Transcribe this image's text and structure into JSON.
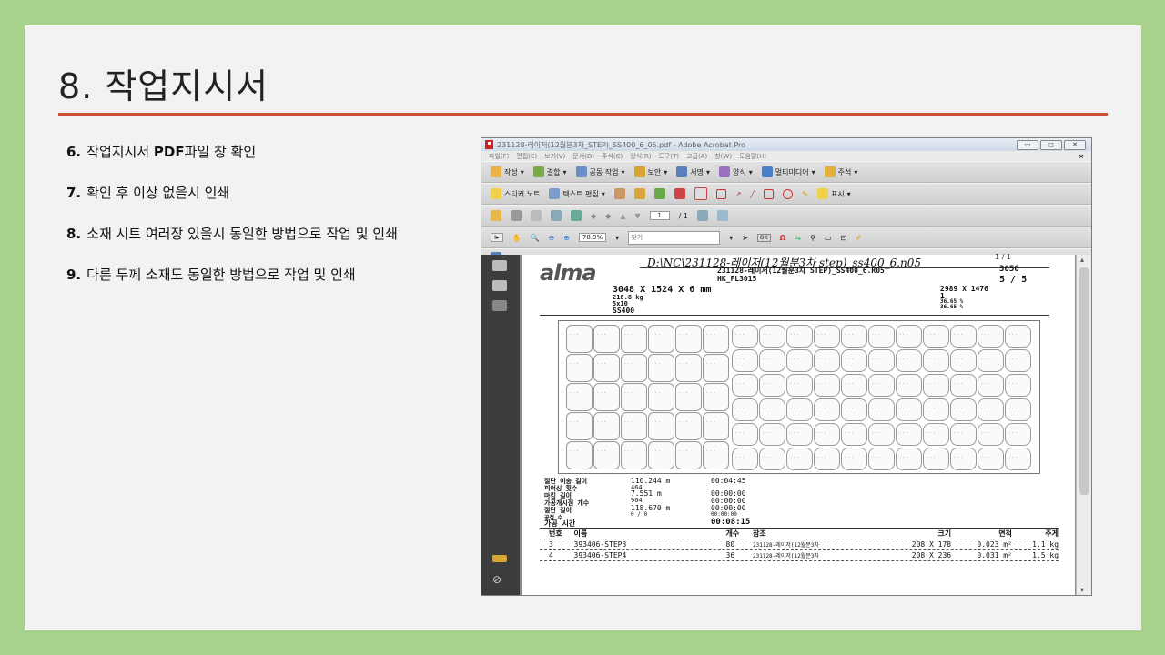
{
  "slide": {
    "title": "8. 작업지시서",
    "steps": [
      {
        "num": "6.",
        "text": "작업지시서 ",
        "bold": "PDF",
        "rest": "파일 창 확인"
      },
      {
        "num": "7.",
        "text": "확인 후 이상 없을시 인쇄",
        "bold": "",
        "rest": ""
      },
      {
        "num": "8.",
        "text": "소재 시트 여러장 있을시 동일한 방법으로 작업 및 인쇄",
        "bold": "",
        "rest": ""
      },
      {
        "num": "9.",
        "text": "다른 두께 소재도 동일한 방법으로 작업 및 인쇄",
        "bold": "",
        "rest": ""
      }
    ]
  },
  "acrobat": {
    "window_title": "231128-레이저(12월분3차_STEP)_SS400_6_05.pdf - Adobe Acrobat Pro",
    "menu": [
      "파일(F)",
      "편집(E)",
      "보기(V)",
      "문서(D)",
      "주석(C)",
      "양식(R)",
      "도구(T)",
      "고급(A)",
      "창(W)",
      "도움말(H)"
    ],
    "toolbar1": [
      "작성",
      "결합",
      "공동 작업",
      "보안",
      "서명",
      "양식",
      "멀티미디어",
      "주석"
    ],
    "toolbar2": [
      "스티커 노트",
      "텍스트 편집",
      "표시"
    ],
    "zoom": "78.9%",
    "find_placeholder": "찾기",
    "page_current": "1",
    "page_total": "/ 1"
  },
  "document": {
    "logo": "alma",
    "path": "D:\\NC\\231128-레이저(12월분3차 step)_ss400_6.n05",
    "page_label": "1 / 1",
    "nesting_name": "231128-레이저(12월분3차 STEP)_SS400_6.R05",
    "machine": "HK_FL3015",
    "nc_number": "3656",
    "nest_count": "5 / 5",
    "sheet_size": "3048 X 1524 X 6 mm",
    "sheet_weight": "218.8 kg",
    "sheet_qty": "5x10",
    "material": "SS400",
    "used_size": "2989 X 1476",
    "repeat": "1",
    "usage1": "36.65 %",
    "usage2": "36.65 %",
    "stats": [
      {
        "label": "절단 이송 길이",
        "value": "110.244 m",
        "time": "00:04:45"
      },
      {
        "label": "피어싱 횟수",
        "value": "464",
        "time": ""
      },
      {
        "label": "마킹 길이",
        "value": "7.551 m",
        "time": "00:00:00"
      },
      {
        "label": "가공개시점 개수",
        "value": "964",
        "time": "00:00:00"
      },
      {
        "label": "절단 길이",
        "value": "118.670 m",
        "time": "00:00:00"
      },
      {
        "label": "공정 수",
        "value": "0 / 0",
        "time": "00:00:00"
      },
      {
        "label": "가공 시간",
        "value": "",
        "time": "00:08:15"
      }
    ],
    "parts_header": [
      "번호",
      "이름",
      "개수",
      "참조",
      "크기",
      "면적",
      "주게"
    ],
    "parts": [
      {
        "no": "3",
        "name": "393406-STEP3",
        "qty": "80",
        "ref": "231128-레이저(12월분3차",
        "size": "208 X 178",
        "area": "0.023 m²",
        "weight": "1.1 kg"
      },
      {
        "no": "4",
        "name": "393406-STEP4",
        "qty": "36",
        "ref": "231128-레이저(12월분3차",
        "size": "208 X 236",
        "area": "0.031 m²",
        "weight": "1.5 kg"
      }
    ]
  }
}
